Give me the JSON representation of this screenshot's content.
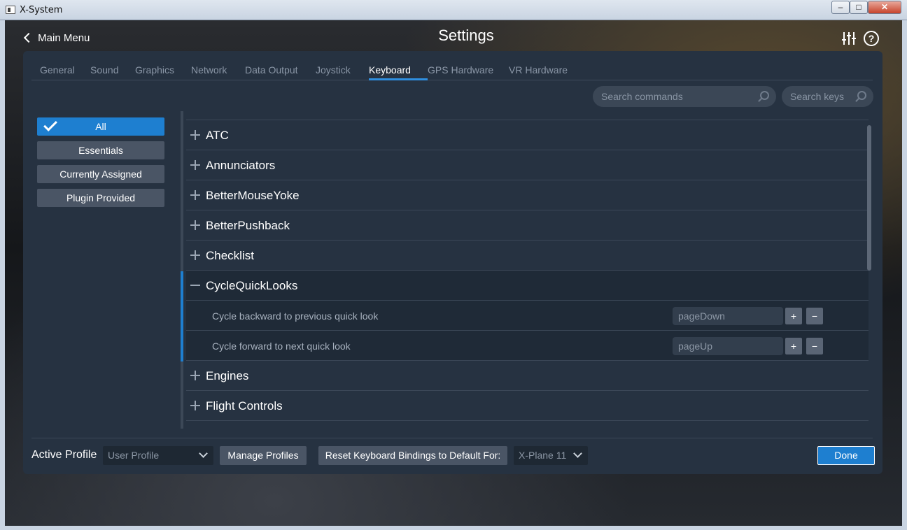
{
  "window": {
    "title": "X-System",
    "minimize": "–",
    "maximize": "□",
    "close": "✕"
  },
  "header": {
    "back_label": "Main Menu",
    "title": "Settings",
    "help_glyph": "?"
  },
  "tabs": [
    {
      "label": "General"
    },
    {
      "label": "Sound"
    },
    {
      "label": "Graphics"
    },
    {
      "label": "Network"
    },
    {
      "label": "Data Output"
    },
    {
      "label": "Joystick"
    },
    {
      "label": "Keyboard"
    },
    {
      "label": "GPS Hardware"
    },
    {
      "label": "VR Hardware"
    }
  ],
  "active_tab": "Keyboard",
  "search": {
    "commands_placeholder": "Search commands",
    "keys_placeholder": "Search keys"
  },
  "filters": [
    {
      "label": "All",
      "active": true
    },
    {
      "label": "Essentials"
    },
    {
      "label": "Currently Assigned"
    },
    {
      "label": "Plugin Provided"
    }
  ],
  "categories": [
    {
      "label": "ATC"
    },
    {
      "label": "Annunciators"
    },
    {
      "label": "BetterMouseYoke"
    },
    {
      "label": "BetterPushback"
    },
    {
      "label": "Checklist"
    },
    {
      "label": "CycleQuickLooks",
      "expanded": true,
      "commands": [
        {
          "label": "Cycle backward to previous quick look",
          "key": "pageDown"
        },
        {
          "label": "Cycle forward to next quick look",
          "key": "pageUp"
        }
      ]
    },
    {
      "label": "Engines"
    },
    {
      "label": "Flight Controls"
    }
  ],
  "key_buttons": {
    "add": "+",
    "remove": "−"
  },
  "footer": {
    "active_profile_label": "Active Profile",
    "profile_value": "User Profile",
    "manage_label": "Manage Profiles",
    "reset_label": "Reset Keyboard Bindings to Default For:",
    "version_value": "X-Plane 11",
    "done_label": "Done"
  },
  "colors": {
    "accent": "#1e7fd0",
    "panel": "#263241",
    "filter_button": "#4a5565"
  }
}
